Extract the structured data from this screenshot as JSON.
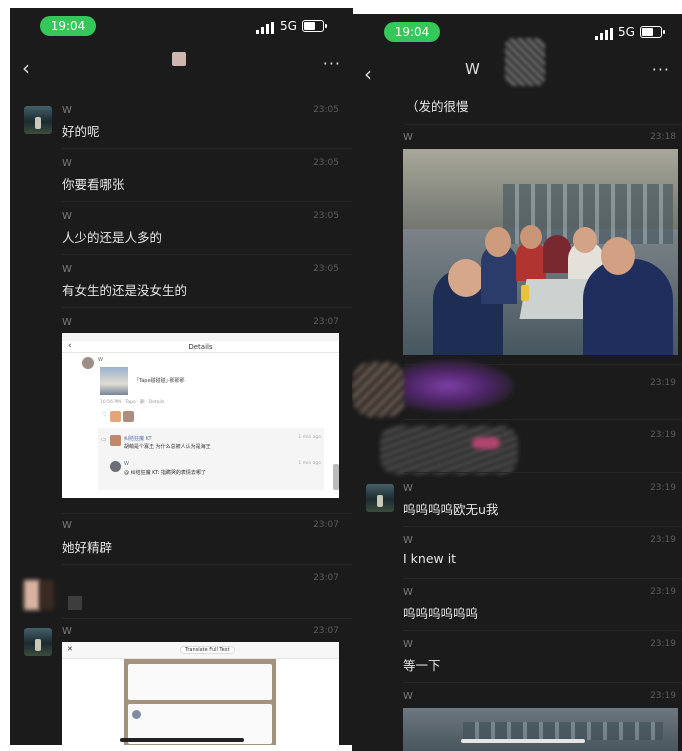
{
  "colors": {
    "bg": "#1b1b1b",
    "time_pill": "#35c759",
    "separator": "#262626"
  },
  "left": {
    "status": {
      "time": "19:04",
      "network": "5G"
    },
    "nav": {
      "back_icon": "chevron-left-icon",
      "more": "···"
    },
    "messages": [
      {
        "sender": "W",
        "time": "23:05",
        "text": "好的呢"
      },
      {
        "sender": "W",
        "time": "23:05",
        "text": "你要看哪张"
      },
      {
        "sender": "W",
        "time": "23:05",
        "text": "人少的还是人多的"
      },
      {
        "sender": "W",
        "time": "23:05",
        "text": "有女生的还是没女生的"
      },
      {
        "sender": "W",
        "time": "23:07"
      },
      {
        "sender": "W",
        "time": "23:07",
        "text": "她好精辟"
      },
      {
        "time": "23:07"
      },
      {
        "sender": "W",
        "time": "23:07"
      }
    ],
    "shot1": {
      "title": "Details",
      "sender": "W",
      "post_text": "「Tape碰碰碰」·那那那",
      "meta": "10:56 PM · Tape · 删 · Details",
      "comment1_name": "纠结狂魔 KT",
      "comment1_text": "胡萌是个寡王 为什么总被人认为是海王",
      "comment1_time": "1 min ago",
      "comment2_name": "W",
      "comment2_text": "@ 纠结狂魔 KT: 指瞒哭的表情去哪了",
      "comment2_time": "1 min ago"
    },
    "shot2": {
      "header": "Translate Full Text"
    }
  },
  "right": {
    "status": {
      "time": "19:04",
      "network": "5G"
    },
    "nav": {
      "title": "W",
      "more": "···"
    },
    "messages": [
      {
        "text": "（发的很慢"
      },
      {
        "sender": "W",
        "time": "23:18"
      },
      {
        "time": "23:19"
      },
      {
        "time": "23:19"
      },
      {
        "sender": "W",
        "time": "23:19",
        "text": "呜呜呜呜欧无u我"
      },
      {
        "sender": "W",
        "time": "23:19",
        "text": "I knew it"
      },
      {
        "sender": "W",
        "time": "23:19",
        "text": "呜呜呜呜呜呜"
      },
      {
        "sender": "W",
        "time": "23:19",
        "text": "等一下"
      },
      {
        "sender": "W",
        "time": "23:19"
      }
    ]
  }
}
